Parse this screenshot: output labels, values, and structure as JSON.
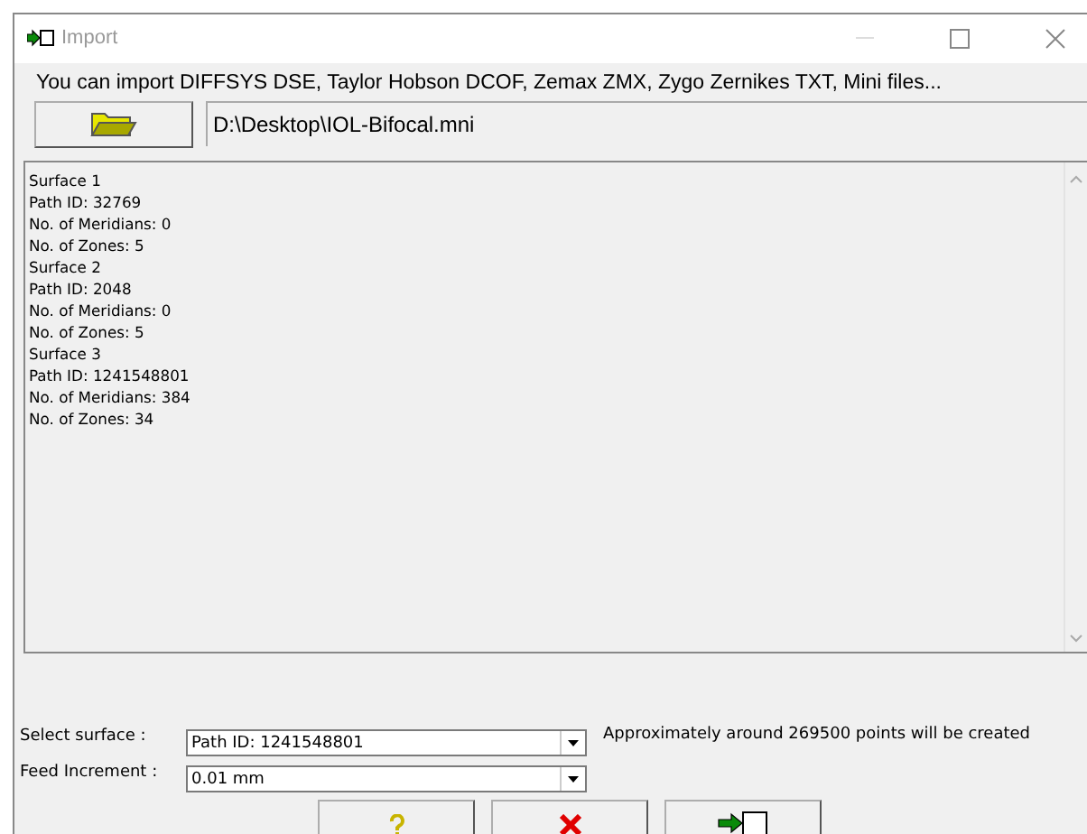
{
  "window": {
    "title": "Import"
  },
  "info": "You can import DIFFSYS DSE, Taylor Hobson DCOF, Zemax ZMX, Zygo Zernikes TXT, Mini files...",
  "file_path": "D:\\Desktop\\IOL-Bifocal.mni",
  "log_lines": [
    "Surface 1",
    "Path ID: 32769",
    "No. of Meridians: 0",
    "No. of Zones: 5",
    "Surface 2",
    "Path ID: 2048",
    "No. of Meridians: 0",
    "No. of Zones: 5",
    "Surface 3",
    "Path ID: 1241548801",
    "No. of Meridians: 384",
    "No. of Zones: 34"
  ],
  "select_surface": {
    "label": "Select surface :",
    "value": "Path ID: 1241548801"
  },
  "points_note": "Approximately around 269500 points will be created",
  "feed_increment": {
    "label": "Feed Increment :",
    "value": "0.01 mm"
  },
  "buttons": [
    {
      "kind": "help"
    },
    {
      "kind": "cancel"
    },
    {
      "kind": "import"
    }
  ]
}
